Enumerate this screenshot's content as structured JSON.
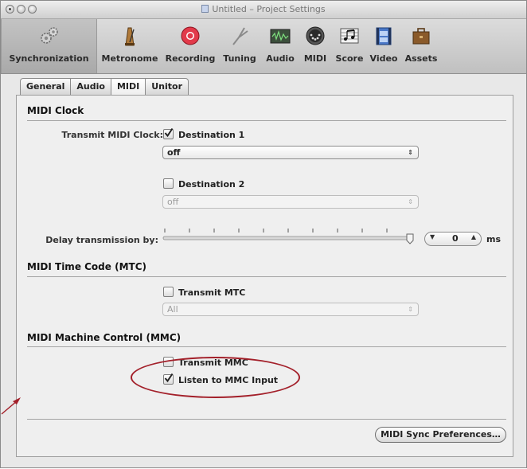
{
  "window": {
    "title": "Untitled – Project Settings"
  },
  "toolbar": {
    "items": [
      {
        "label": "Synchronization",
        "icon": "gears-icon",
        "selected": true
      },
      {
        "label": "Metronome",
        "icon": "metronome-icon"
      },
      {
        "label": "Recording",
        "icon": "record-icon"
      },
      {
        "label": "Tuning",
        "icon": "tuning-fork-icon"
      },
      {
        "label": "Audio",
        "icon": "audio-waveform-icon"
      },
      {
        "label": "MIDI",
        "icon": "midi-connector-icon"
      },
      {
        "label": "Score",
        "icon": "score-notes-icon"
      },
      {
        "label": "Video",
        "icon": "video-film-icon"
      },
      {
        "label": "Assets",
        "icon": "briefcase-icon"
      }
    ]
  },
  "tabs": [
    {
      "label": "General"
    },
    {
      "label": "Audio"
    },
    {
      "label": "MIDI",
      "active": true
    },
    {
      "label": "Unitor"
    }
  ],
  "midi_clock": {
    "heading": "MIDI Clock",
    "transmit_label": "Transmit MIDI Clock:",
    "dest1": {
      "label": "Destination 1",
      "checked": true,
      "popup_value": "off"
    },
    "dest2": {
      "label": "Destination 2",
      "checked": false,
      "popup_value": "off"
    },
    "delay_label": "Delay transmission by:",
    "delay_value": "0",
    "delay_unit": "ms"
  },
  "mtc": {
    "heading": "MIDI Time Code (MTC)",
    "transmit_label": "Transmit MTC",
    "checked": false,
    "popup_value": "All"
  },
  "mmc": {
    "heading": "MIDI Machine Control (MMC)",
    "transmit_label": "Transmit MMC",
    "transmit_checked": false,
    "listen_label": "Listen to MMC Input",
    "listen_checked": true
  },
  "footer": {
    "button_label": "MIDI Sync Preferences…"
  },
  "colors": {
    "annotation": "#a3202a"
  }
}
